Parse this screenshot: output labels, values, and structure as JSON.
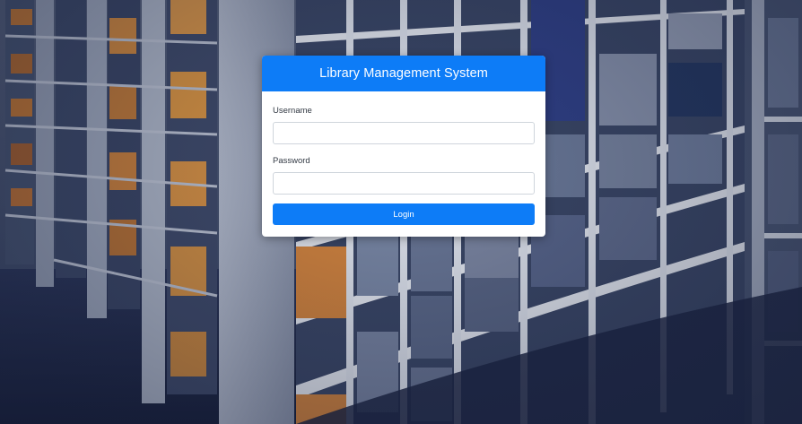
{
  "login": {
    "title": "Library Management System",
    "username_label": "Username",
    "username_value": "",
    "password_label": "Password",
    "password_value": "",
    "button_label": "Login"
  },
  "colors": {
    "primary": "#0d7cf7",
    "background_tint": "#2b3657",
    "card": "#ffffff"
  }
}
